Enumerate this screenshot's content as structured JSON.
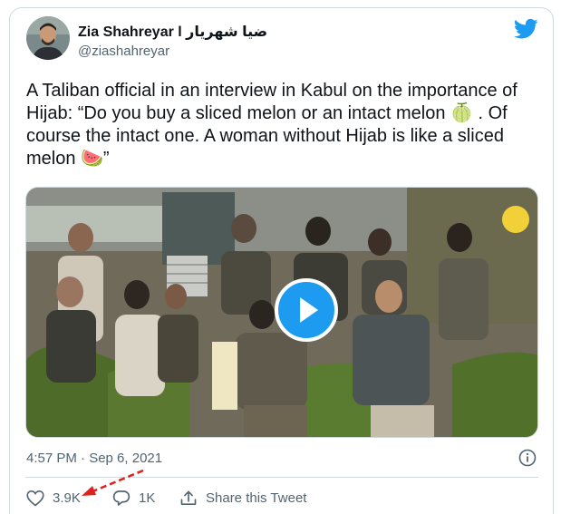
{
  "author": {
    "name": "Zia Shahreyar l ضیا شهریار",
    "handle": "@ziashahreyar"
  },
  "tweet": {
    "text": "A Taliban official in an interview in Kabul on the importance of Hijab: “Do you buy a sliced melon or an intact melon 🍈 . Of course the intact one. A woman without Hijab is like a sliced melon 🍉”",
    "timestamp": "4:57 PM · Sep 6, 2021"
  },
  "actions": {
    "likes": "3.9K",
    "replies": "1K",
    "share_label": "Share this Tweet"
  },
  "icons": {
    "brand": "twitter-bird-icon",
    "info": "info-icon",
    "like": "heart-icon",
    "reply": "reply-icon",
    "share": "share-icon",
    "play": "play-icon"
  },
  "colors": {
    "brand": "#1d9bf0",
    "annotation_arrow": "#e0201b"
  }
}
